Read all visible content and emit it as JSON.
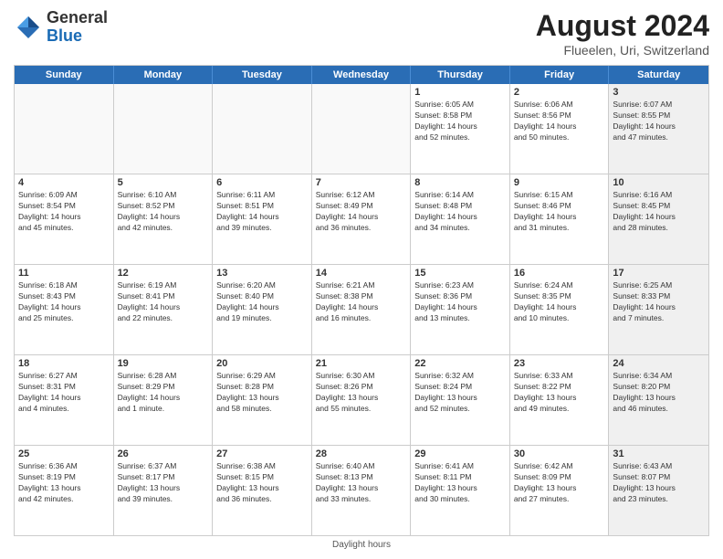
{
  "header": {
    "logo_general": "General",
    "logo_blue": "Blue",
    "title": "August 2024",
    "location": "Flueelen, Uri, Switzerland"
  },
  "days_of_week": [
    "Sunday",
    "Monday",
    "Tuesday",
    "Wednesday",
    "Thursday",
    "Friday",
    "Saturday"
  ],
  "footer_text": "Daylight hours",
  "weeks": [
    [
      {
        "day": "",
        "info": "",
        "empty": true
      },
      {
        "day": "",
        "info": "",
        "empty": true
      },
      {
        "day": "",
        "info": "",
        "empty": true
      },
      {
        "day": "",
        "info": "",
        "empty": true
      },
      {
        "day": "1",
        "info": "Sunrise: 6:05 AM\nSunset: 8:58 PM\nDaylight: 14 hours\nand 52 minutes."
      },
      {
        "day": "2",
        "info": "Sunrise: 6:06 AM\nSunset: 8:56 PM\nDaylight: 14 hours\nand 50 minutes."
      },
      {
        "day": "3",
        "info": "Sunrise: 6:07 AM\nSunset: 8:55 PM\nDaylight: 14 hours\nand 47 minutes.",
        "shaded": true
      }
    ],
    [
      {
        "day": "4",
        "info": "Sunrise: 6:09 AM\nSunset: 8:54 PM\nDaylight: 14 hours\nand 45 minutes."
      },
      {
        "day": "5",
        "info": "Sunrise: 6:10 AM\nSunset: 8:52 PM\nDaylight: 14 hours\nand 42 minutes."
      },
      {
        "day": "6",
        "info": "Sunrise: 6:11 AM\nSunset: 8:51 PM\nDaylight: 14 hours\nand 39 minutes."
      },
      {
        "day": "7",
        "info": "Sunrise: 6:12 AM\nSunset: 8:49 PM\nDaylight: 14 hours\nand 36 minutes."
      },
      {
        "day": "8",
        "info": "Sunrise: 6:14 AM\nSunset: 8:48 PM\nDaylight: 14 hours\nand 34 minutes."
      },
      {
        "day": "9",
        "info": "Sunrise: 6:15 AM\nSunset: 8:46 PM\nDaylight: 14 hours\nand 31 minutes."
      },
      {
        "day": "10",
        "info": "Sunrise: 6:16 AM\nSunset: 8:45 PM\nDaylight: 14 hours\nand 28 minutes.",
        "shaded": true
      }
    ],
    [
      {
        "day": "11",
        "info": "Sunrise: 6:18 AM\nSunset: 8:43 PM\nDaylight: 14 hours\nand 25 minutes."
      },
      {
        "day": "12",
        "info": "Sunrise: 6:19 AM\nSunset: 8:41 PM\nDaylight: 14 hours\nand 22 minutes."
      },
      {
        "day": "13",
        "info": "Sunrise: 6:20 AM\nSunset: 8:40 PM\nDaylight: 14 hours\nand 19 minutes."
      },
      {
        "day": "14",
        "info": "Sunrise: 6:21 AM\nSunset: 8:38 PM\nDaylight: 14 hours\nand 16 minutes."
      },
      {
        "day": "15",
        "info": "Sunrise: 6:23 AM\nSunset: 8:36 PM\nDaylight: 14 hours\nand 13 minutes."
      },
      {
        "day": "16",
        "info": "Sunrise: 6:24 AM\nSunset: 8:35 PM\nDaylight: 14 hours\nand 10 minutes."
      },
      {
        "day": "17",
        "info": "Sunrise: 6:25 AM\nSunset: 8:33 PM\nDaylight: 14 hours\nand 7 minutes.",
        "shaded": true
      }
    ],
    [
      {
        "day": "18",
        "info": "Sunrise: 6:27 AM\nSunset: 8:31 PM\nDaylight: 14 hours\nand 4 minutes."
      },
      {
        "day": "19",
        "info": "Sunrise: 6:28 AM\nSunset: 8:29 PM\nDaylight: 14 hours\nand 1 minute."
      },
      {
        "day": "20",
        "info": "Sunrise: 6:29 AM\nSunset: 8:28 PM\nDaylight: 13 hours\nand 58 minutes."
      },
      {
        "day": "21",
        "info": "Sunrise: 6:30 AM\nSunset: 8:26 PM\nDaylight: 13 hours\nand 55 minutes."
      },
      {
        "day": "22",
        "info": "Sunrise: 6:32 AM\nSunset: 8:24 PM\nDaylight: 13 hours\nand 52 minutes."
      },
      {
        "day": "23",
        "info": "Sunrise: 6:33 AM\nSunset: 8:22 PM\nDaylight: 13 hours\nand 49 minutes."
      },
      {
        "day": "24",
        "info": "Sunrise: 6:34 AM\nSunset: 8:20 PM\nDaylight: 13 hours\nand 46 minutes.",
        "shaded": true
      }
    ],
    [
      {
        "day": "25",
        "info": "Sunrise: 6:36 AM\nSunset: 8:19 PM\nDaylight: 13 hours\nand 42 minutes."
      },
      {
        "day": "26",
        "info": "Sunrise: 6:37 AM\nSunset: 8:17 PM\nDaylight: 13 hours\nand 39 minutes."
      },
      {
        "day": "27",
        "info": "Sunrise: 6:38 AM\nSunset: 8:15 PM\nDaylight: 13 hours\nand 36 minutes."
      },
      {
        "day": "28",
        "info": "Sunrise: 6:40 AM\nSunset: 8:13 PM\nDaylight: 13 hours\nand 33 minutes."
      },
      {
        "day": "29",
        "info": "Sunrise: 6:41 AM\nSunset: 8:11 PM\nDaylight: 13 hours\nand 30 minutes."
      },
      {
        "day": "30",
        "info": "Sunrise: 6:42 AM\nSunset: 8:09 PM\nDaylight: 13 hours\nand 27 minutes."
      },
      {
        "day": "31",
        "info": "Sunrise: 6:43 AM\nSunset: 8:07 PM\nDaylight: 13 hours\nand 23 minutes.",
        "shaded": true
      }
    ]
  ]
}
